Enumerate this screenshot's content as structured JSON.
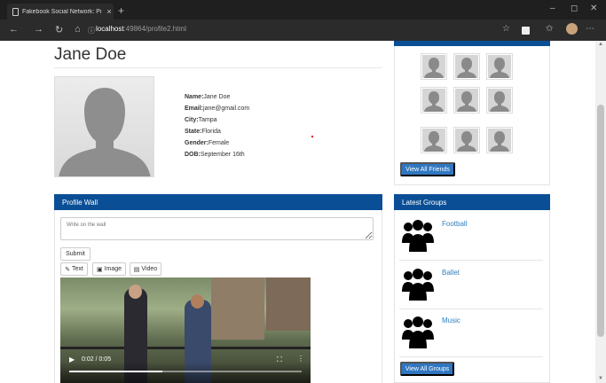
{
  "browser": {
    "tab_title": "Fakebook Social Network: Profile",
    "tab_close": "×",
    "new_tab": "+",
    "window_controls": [
      "–",
      "◻",
      "✕"
    ],
    "url_host": "localhost",
    "url_rest": ":49864/profile2.html"
  },
  "profile": {
    "name": "Jane Doe",
    "fields": [
      {
        "label": "Name:",
        "value": "Jane Doe"
      },
      {
        "label": "Email:",
        "value": "jane@gmail.com"
      },
      {
        "label": "City:",
        "value": "Tampa"
      },
      {
        "label": "State:",
        "value": "Florida"
      },
      {
        "label": "Gender:",
        "value": "Female"
      },
      {
        "label": "DOB:",
        "value": "September 16th"
      }
    ]
  },
  "wall": {
    "title": "Profile Wall",
    "placeholder": "Write on the wall",
    "submit": "Submit",
    "text_btn": "Text",
    "image_btn": "Image",
    "video_btn": "Video",
    "video_time": "0:02 / 0:05",
    "video_progress": 0.4
  },
  "friends": {
    "view_all": "View All Friends"
  },
  "groups": {
    "title": "Latest Groups",
    "items": [
      "Football",
      "Ballet",
      "Music"
    ],
    "view_all": "View All Groups"
  }
}
